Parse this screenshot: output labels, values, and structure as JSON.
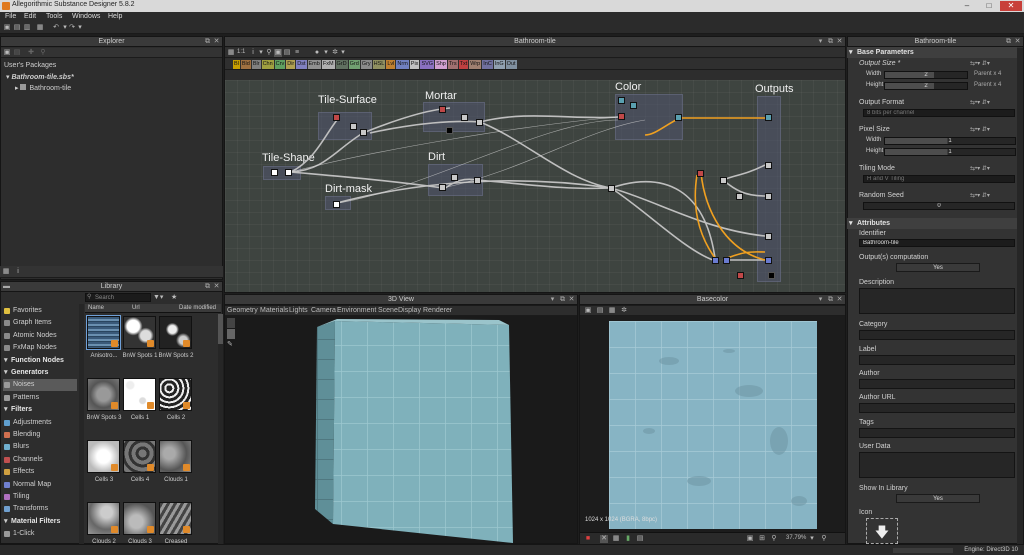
{
  "window": {
    "title": "Allegorithmic Substance Designer 5.8.2",
    "minimize": "–",
    "maximize": "□",
    "close": "✕",
    "accent": "#e07a1f"
  },
  "menu": [
    "File",
    "Edit",
    "Tools",
    "Windows",
    "Help"
  ],
  "explorer": {
    "title": "Explorer",
    "root": "User's Packages",
    "package": "Bathroom-tile.sbs*",
    "graph": "Bathroom-tile"
  },
  "graph": {
    "title": "Bathroom-tile",
    "zoom": "1:1",
    "atomics": [
      "Bl",
      "Bld",
      "Blr",
      "Chn",
      "Crv",
      "Dir",
      "Dst",
      "Emb",
      "FxM",
      "GrD",
      "Grd",
      "Gry",
      "HSL",
      "Lvl",
      "Nrm",
      "Pix",
      "SVG",
      "Shp",
      "Trs",
      "Txt",
      "Wrp",
      "InC",
      "InG",
      "Out"
    ],
    "frames": {
      "tile_surface": "Tile-Surface",
      "mortar": "Mortar",
      "color": "Color",
      "outputs": "Outputs",
      "tile_shape": "Tile-Shape",
      "dirt": "Dirt",
      "dirt_mask": "Dirt-mask"
    }
  },
  "library": {
    "title": "Library",
    "search_placeholder": "Search",
    "col_name": "Name",
    "col_url": "Url",
    "col_date": "Date modified",
    "categories": [
      {
        "label": "Favorites",
        "head": false,
        "sel": false,
        "color": "#e0c040"
      },
      {
        "label": "Graph Items",
        "head": false,
        "sel": false,
        "color": "#8a8a8a"
      },
      {
        "label": "Atomic Nodes",
        "head": false,
        "sel": false,
        "color": "#8a8a8a"
      },
      {
        "label": "FxMap Nodes",
        "head": false,
        "sel": false,
        "color": "#8a8a8a"
      },
      {
        "label": "Function Nodes",
        "head": true,
        "sel": false,
        "color": "#8a8a8a"
      },
      {
        "label": "Generators",
        "head": true,
        "sel": false,
        "color": "#8a8a8a"
      },
      {
        "label": "Noises",
        "head": false,
        "sel": true,
        "color": "#9a9a9a"
      },
      {
        "label": "Patterns",
        "head": false,
        "sel": false,
        "color": "#9a9a9a"
      },
      {
        "label": "Filters",
        "head": true,
        "sel": false,
        "color": "#8a8a8a"
      },
      {
        "label": "Adjustments",
        "head": false,
        "sel": false,
        "color": "#60a0d0"
      },
      {
        "label": "Blending",
        "head": false,
        "sel": false,
        "color": "#d07050"
      },
      {
        "label": "Blurs",
        "head": false,
        "sel": false,
        "color": "#70b0d0"
      },
      {
        "label": "Channels",
        "head": false,
        "sel": false,
        "color": "#c05050"
      },
      {
        "label": "Effects",
        "head": false,
        "sel": false,
        "color": "#d0a040"
      },
      {
        "label": "Normal Map",
        "head": false,
        "sel": false,
        "color": "#7080d0"
      },
      {
        "label": "Tiling",
        "head": false,
        "sel": false,
        "color": "#b070c0"
      },
      {
        "label": "Transforms",
        "head": false,
        "sel": false,
        "color": "#70a0d0"
      },
      {
        "label": "Material Filters",
        "head": true,
        "sel": false,
        "color": "#8a8a8a"
      },
      {
        "label": "1-Click",
        "head": false,
        "sel": false,
        "color": "#9a9a9a"
      }
    ],
    "items": [
      {
        "label": "Anisotro...",
        "tex": "aniso"
      },
      {
        "label": "BnW Spots 1",
        "tex": "spots1"
      },
      {
        "label": "BnW Spots 2",
        "tex": "spots2"
      },
      {
        "label": "BnW Spots 3",
        "tex": "spots3"
      },
      {
        "label": "Cells 1",
        "tex": "cells1"
      },
      {
        "label": "Cells 2",
        "tex": "cells2"
      },
      {
        "label": "Cells 3",
        "tex": "cells3"
      },
      {
        "label": "Cells 4",
        "tex": "cells4"
      },
      {
        "label": "Clouds 1",
        "tex": "clouds1"
      },
      {
        "label": "Clouds 2",
        "tex": "clouds2"
      },
      {
        "label": "Clouds 3",
        "tex": "clouds3"
      },
      {
        "label": "Creased",
        "tex": "creased"
      }
    ]
  },
  "view3d": {
    "title": "3D View",
    "menu": [
      "Geometry",
      "Materials",
      "Lights",
      "Camera",
      "Environment",
      "Scene",
      "Display",
      "Renderer"
    ]
  },
  "basecolor": {
    "title": "Basecolor",
    "info": "1024 x 1024 (BGRA, 8bpc)",
    "zoom": "37.79%"
  },
  "properties": {
    "title": "Bathroom-tile",
    "base_params": "Base Parameters",
    "output_size": "Output Size *",
    "width": "Width",
    "height": "Height",
    "size_val": "2",
    "parent_w": "Parent x 4",
    "parent_h": "Parent x 4",
    "output_format": "Output Format",
    "output_format_val": "8 bits per channel",
    "pixel_size": "Pixel Size",
    "px_w": "1",
    "px_h": "1",
    "tiling_mode": "Tiling Mode",
    "tiling_val": "H and V Tiling",
    "random_seed": "Random Seed",
    "seed_val": "0",
    "attributes": "Attributes",
    "identifier": "Identifier",
    "identifier_val": "Bathroom-tile",
    "outputs_comp": "Output(s) computation",
    "yes": "Yes",
    "description": "Description",
    "category": "Category",
    "label": "Label",
    "author": "Author",
    "author_url": "Author URL",
    "tags": "Tags",
    "user_data": "User Data",
    "show_in_library": "Show In Library",
    "icon": "Icon"
  },
  "status": {
    "engine": "Engine: Direct3D 10"
  }
}
